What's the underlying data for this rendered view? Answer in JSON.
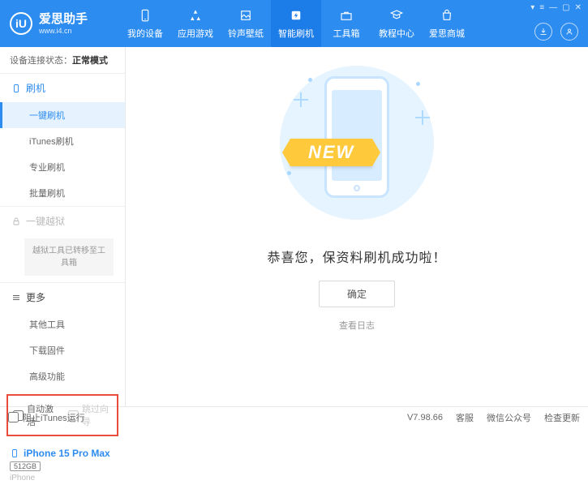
{
  "header": {
    "logo_text": "iU",
    "title": "爱思助手",
    "url": "www.i4.cn",
    "nav": [
      {
        "label": "我的设备"
      },
      {
        "label": "应用游戏"
      },
      {
        "label": "铃声壁纸"
      },
      {
        "label": "智能刷机"
      },
      {
        "label": "工具箱"
      },
      {
        "label": "教程中心"
      },
      {
        "label": "爱思商城"
      }
    ],
    "win_controls": [
      "▾",
      "≡",
      "—",
      "▢",
      "✕"
    ]
  },
  "sidebar": {
    "status_label": "设备连接状态：",
    "status_value": "正常模式",
    "sections": {
      "flash": {
        "title": "刷机",
        "items": [
          "一键刷机",
          "iTunes刷机",
          "专业刷机",
          "批量刷机"
        ]
      },
      "jailbreak": {
        "title": "一键越狱",
        "note": "越狱工具已转移至工具箱"
      },
      "more": {
        "title": "更多",
        "items": [
          "其他工具",
          "下载固件",
          "高级功能"
        ]
      }
    },
    "checkboxes": {
      "auto_activate": "自动激活",
      "skip_guide": "跳过向导"
    },
    "device": {
      "name": "iPhone 15 Pro Max",
      "storage": "512GB",
      "type": "iPhone"
    }
  },
  "main": {
    "ribbon": "NEW",
    "message": "恭喜您，保资料刷机成功啦！",
    "ok_button": "确定",
    "view_log": "查看日志"
  },
  "footer": {
    "block_itunes": "阻止iTunes运行",
    "version": "V7.98.66",
    "links": [
      "客服",
      "微信公众号",
      "检查更新"
    ]
  }
}
